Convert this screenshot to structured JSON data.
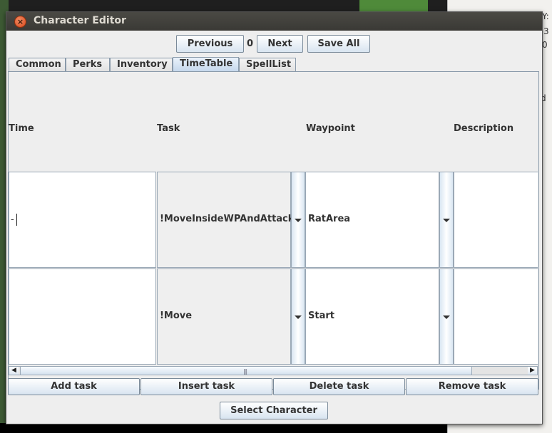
{
  "window": {
    "title": "Character Editor"
  },
  "nav": {
    "previous_label": "Previous",
    "counter": "0",
    "next_label": "Next",
    "save_all_label": "Save All"
  },
  "tabs": [
    {
      "label": "Common"
    },
    {
      "label": "Perks"
    },
    {
      "label": "Inventory"
    },
    {
      "label": "TimeTable",
      "active": true
    },
    {
      "label": "SpellList"
    }
  ],
  "table": {
    "columns": [
      "Time",
      "Task",
      "Waypoint",
      "Description"
    ],
    "rows": [
      {
        "time": "-",
        "task": "!MoveInsideWPAndAttack",
        "waypoint": "RatArea",
        "description": ""
      },
      {
        "time": "",
        "task": "!Move",
        "waypoint": "Start",
        "description": ""
      }
    ]
  },
  "actions": {
    "add_task": "Add task",
    "insert_task": "Insert task",
    "delete_task": "Delete task",
    "remove_task": "Remove task"
  },
  "footer": {
    "select_character": "Select Character"
  },
  "background": {
    "right_text_1": "Y:",
    "right_text_2": "3",
    "right_text_3": "0",
    "right_text_4": "d"
  },
  "colors": {
    "titlebar": "#3a3935",
    "close": "#d8491c",
    "active_tab": "#c5d8ec"
  }
}
